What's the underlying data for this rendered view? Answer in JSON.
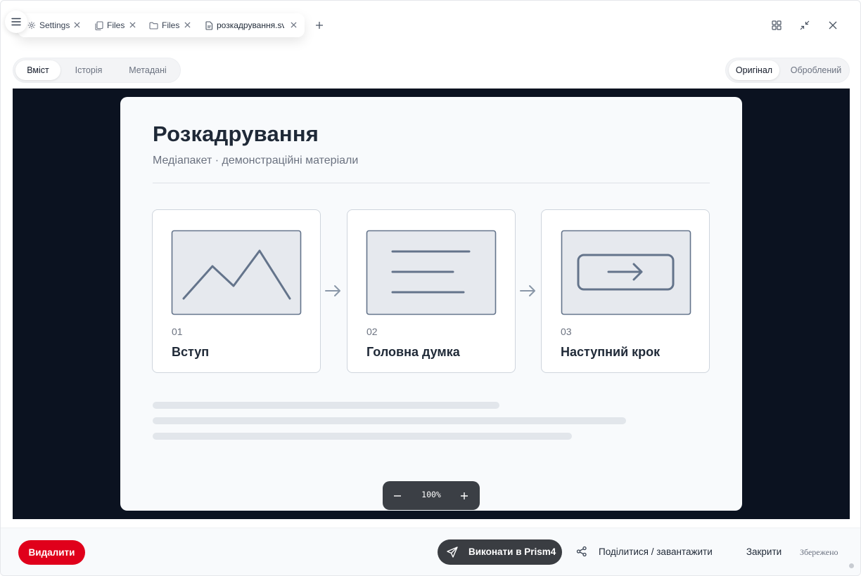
{
  "tabs": [
    {
      "label": "Settings",
      "icon": "gear-icon"
    },
    {
      "label": "Files",
      "icon": "copy-icon"
    },
    {
      "label": "Files",
      "icon": "folder-icon"
    },
    {
      "label": "розкадрування.svg",
      "icon": "file-icon",
      "active": true
    }
  ],
  "view_tabs": {
    "content": "Вміст",
    "history": "Історія",
    "metadata": "Метадані",
    "selected": "Вміст"
  },
  "mode_tabs": {
    "original": "Оригінал",
    "processed": "Оброблений",
    "selected": "Оригінал"
  },
  "document": {
    "title": "Розкадрування",
    "subtitle": "Медіапакет · демонстраційні матеріали",
    "frames": [
      {
        "number": "01",
        "title": "Вступ",
        "illustration": "mountain-chart"
      },
      {
        "number": "02",
        "title": "Головна думка",
        "illustration": "text-lines"
      },
      {
        "number": "03",
        "title": "Наступний крок",
        "illustration": "arrow-button"
      }
    ]
  },
  "zoom": {
    "value": "100%"
  },
  "footer": {
    "delete_label": "Видалити",
    "run_label": "Виконати в Prism4",
    "share_label": "Поділитися / завантажити",
    "close_label": "Закрити",
    "status": "Збережено"
  },
  "colors": {
    "danger": "#e0001b",
    "stage_bg": "#0b1220",
    "dark_button": "#3a3d42"
  }
}
